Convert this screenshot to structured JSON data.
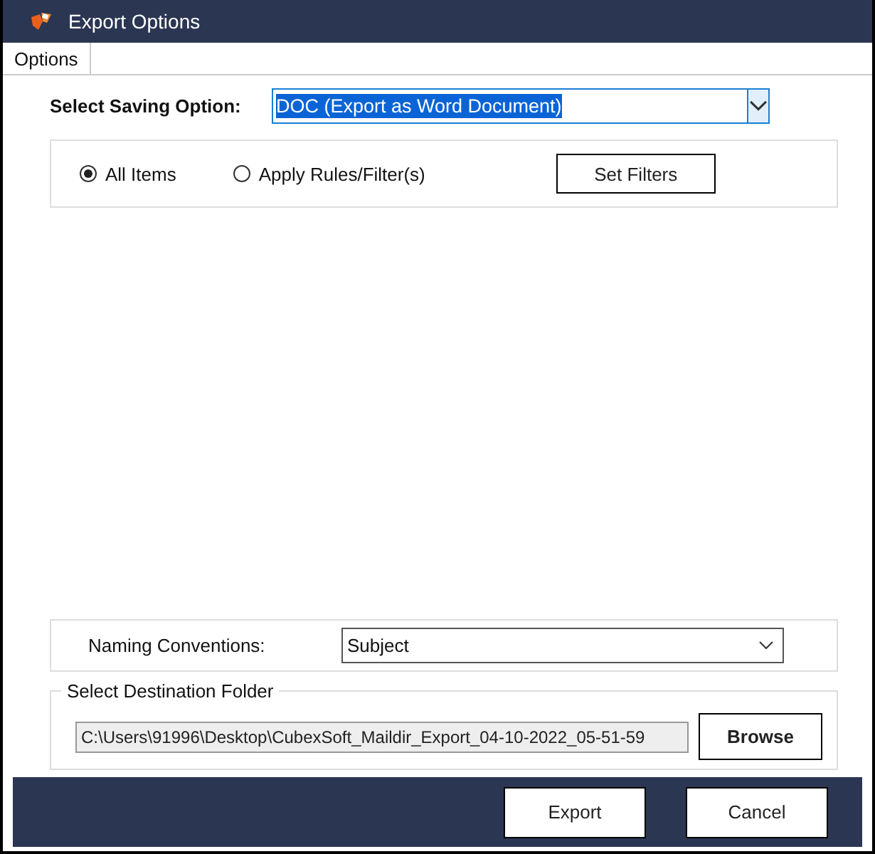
{
  "window": {
    "title": "Export Options"
  },
  "tabs": [
    {
      "label": "Options",
      "selected": true
    }
  ],
  "saving_option": {
    "label": "Select Saving Option:",
    "value": "DOC (Export as Word Document)"
  },
  "item_scope": [
    {
      "label": "All Items",
      "selected": true
    },
    {
      "label": "Apply Rules/Filter(s)",
      "selected": false
    }
  ],
  "set_filters_button": "Set Filters",
  "naming": {
    "label": "Naming Conventions:",
    "value": "Subject"
  },
  "destination": {
    "title": "Select Destination Folder",
    "path": "C:\\Users\\91996\\Desktop\\CubexSoft_Maildir_Export_04-10-2022_05-51-59",
    "button": "Browse"
  },
  "buttons": [
    "Export",
    "Cancel"
  ]
}
